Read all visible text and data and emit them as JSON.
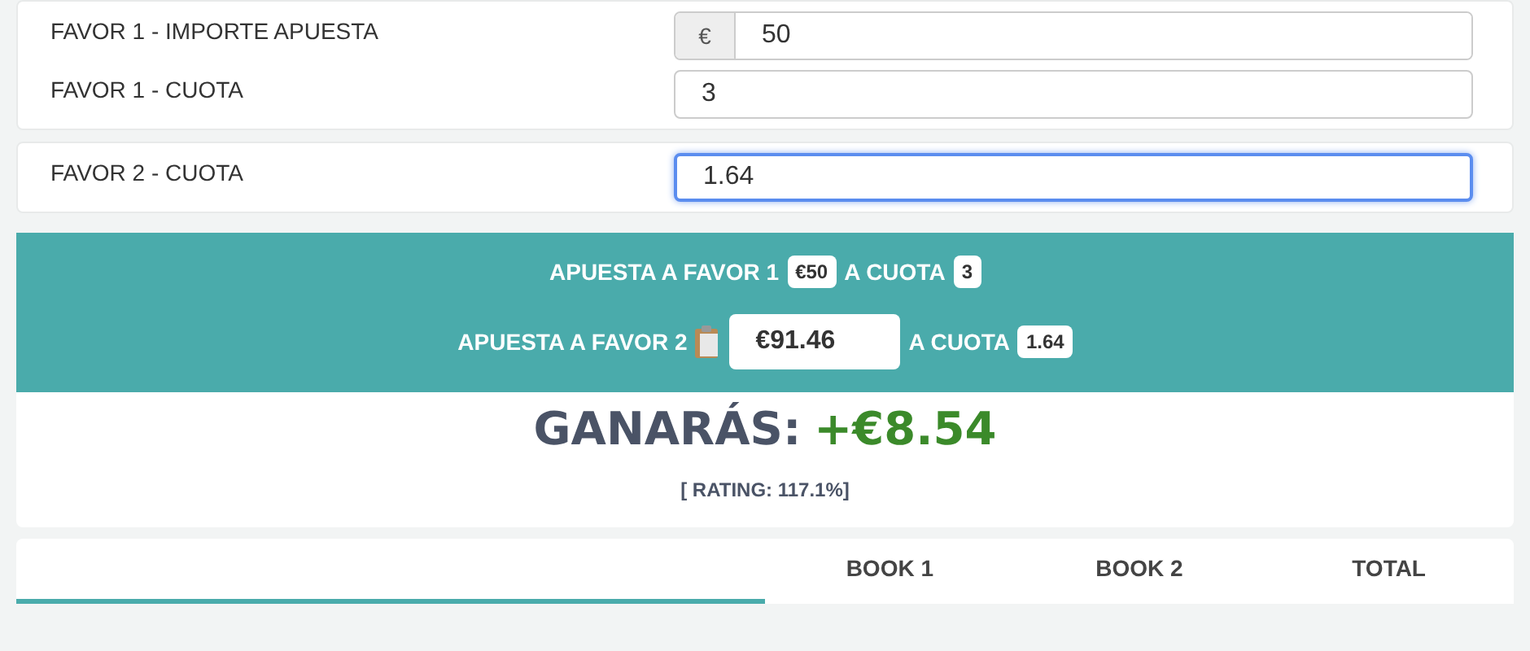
{
  "inputs_card": {
    "fields": [
      {
        "label": "FAVOR 1 - IMPORTE APUESTA",
        "prefix": "€",
        "value": "50",
        "focused": false
      },
      {
        "label": "FAVOR 1 - CUOTA",
        "value": "3",
        "focused": false
      }
    ]
  },
  "favor2_card": {
    "fields": [
      {
        "label": "FAVOR 2 - CUOTA",
        "value": "1.64",
        "focused": true
      }
    ]
  },
  "summary": {
    "line_1": {
      "label": "APUESTA A FAVOR 1",
      "stake": "€50",
      "odds_label": "A CUOTA",
      "odds": "3"
    },
    "line_2": {
      "label": "APUESTA A FAVOR 2",
      "stake": "€91.46",
      "odds_label": "A CUOTA",
      "odds": "1.64"
    }
  },
  "result": {
    "label": "GANARÁS:",
    "amount": "+€8.54",
    "rating": "[ RATING: 117.1%]"
  },
  "table": {
    "columns": [
      "BOOK 1",
      "BOOK 2",
      "TOTAL"
    ]
  }
}
